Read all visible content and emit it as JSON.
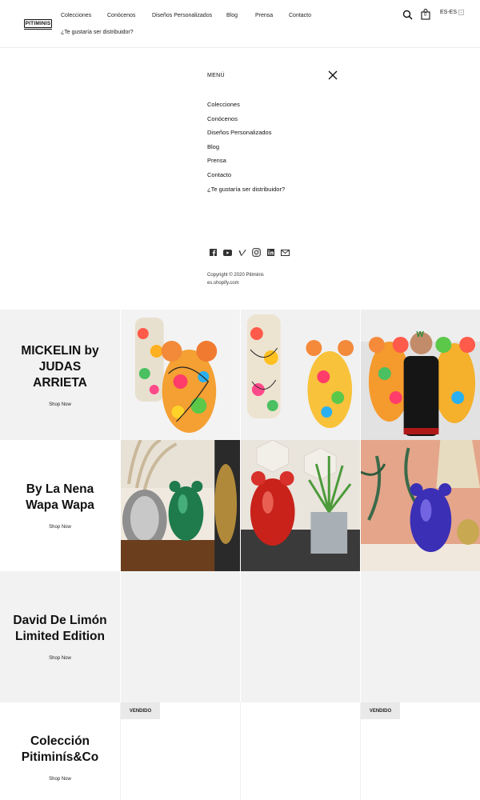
{
  "header": {
    "logo_text": "PITIMINIS",
    "nav": [
      "Colecciones",
      "Conócenos",
      "Diseños Personalizados",
      "Blog",
      "Prensa",
      "Contacto"
    ],
    "nav_second_line": "¿Te gustaría ser distribuidor?",
    "search_icon": "search-icon",
    "cart_icon": "shopping-bag-icon",
    "cart_count": "0",
    "language": "ES-ES"
  },
  "menu": {
    "title": "MENÚ",
    "close_icon": "close-icon",
    "items": [
      "Colecciones",
      "Conócenos",
      "Diseños Personalizados",
      "Blog",
      "Prensa",
      "Contacto",
      "¿Te gustaría ser distribuidor?"
    ],
    "socials": [
      "facebook-icon",
      "youtube-icon",
      "vimeo-icon",
      "instagram-icon",
      "linkedin-icon",
      "mail-icon"
    ],
    "copyright": "Copyright © 2020 Pitiminis es.shopify.com"
  },
  "collections": [
    {
      "title": "MICKELIN by JUDAS ARRIETA",
      "cta": "Shop Now"
    },
    {
      "title": "By La Nena Wapa Wapa",
      "cta": "Shop Now"
    },
    {
      "title": "David De Limón Limited Edition",
      "cta": "Shop Now"
    },
    {
      "title": "Colección Pitiminís&Co",
      "cta": "Shop Now",
      "badges": [
        "VENDIDO",
        "VENDIDO"
      ]
    }
  ],
  "colors": {
    "text": "#111111",
    "panel_gray": "#f2f2f2",
    "badge_bg": "#e9e9e9",
    "bear_green": "#1f7a4c",
    "bear_red": "#c8221a",
    "bear_blue": "#3a2fb5"
  }
}
